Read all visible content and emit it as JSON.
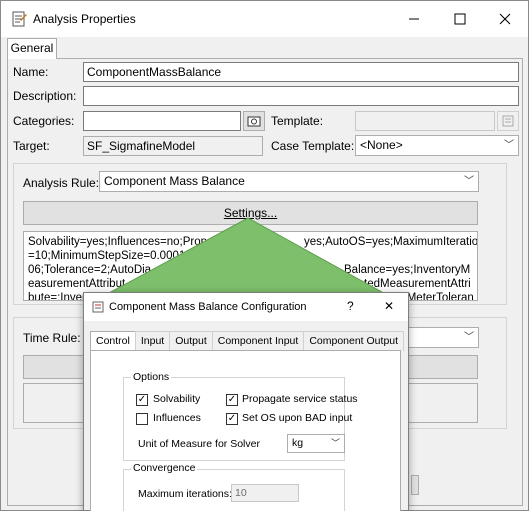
{
  "window": {
    "title": "Analysis Properties",
    "controls": {
      "minimize": "—",
      "maximize": "☐",
      "close": "✕"
    }
  },
  "tabs": {
    "general": "General"
  },
  "form": {
    "name_label": "Name:",
    "name_value": "ComponentMassBalance",
    "description_label": "Description:",
    "description_value": "",
    "categories_label": "Categories:",
    "categories_value": "",
    "template_label": "Template:",
    "template_value": "",
    "target_label": "Target:",
    "target_value": "SF_SigmafineModel",
    "case_template_label": "Case Template:",
    "case_template_value": "<None>",
    "analysis_rule_label": "Analysis Rule:",
    "analysis_rule_value": "Component Mass Balance",
    "settings_button": "Settings...",
    "config_text_line1": "Solvability=yes;Influences=no;Propa",
    "config_text_line1b": "yes;AutoOS=yes;MaximumIterations",
    "config_text_line2": "=10;MinimumStepSize=0.0001",
    "config_text_line3": "06;Tolerance=2;AutoDia",
    "config_text_line3b": "Balance=yes;InventoryM",
    "config_text_line4": "easurementAttribut",
    "config_text_line4b": "tedMeasurementAttri",
    "config_text_line5": "bute=;Invent",
    "config_text_line5b": "=MeterToleran",
    "time_rule_label": "Time Rule:"
  },
  "dialog": {
    "title": "Component Mass Balance Configuration",
    "help": "?",
    "close": "✕",
    "tabs": [
      "Control",
      "Input",
      "Output",
      "Component Input",
      "Component Output"
    ],
    "options_label": "Options",
    "solvability_label": "Solvability",
    "solvability_checked": true,
    "propagate_label": "Propagate service status",
    "propagate_checked": true,
    "influences_label": "Influences",
    "influences_checked": false,
    "set_os_label": "Set OS upon BAD input",
    "set_os_checked": true,
    "uom_label": "Unit of Measure for Solver",
    "uom_value": "kg",
    "convergence_label": "Convergence",
    "max_iter_label": "Maximum iterations:",
    "max_iter_value": "10"
  },
  "colors": {
    "cone_green": "#7dbf6b",
    "cone_edge": "#5f9e4f"
  }
}
